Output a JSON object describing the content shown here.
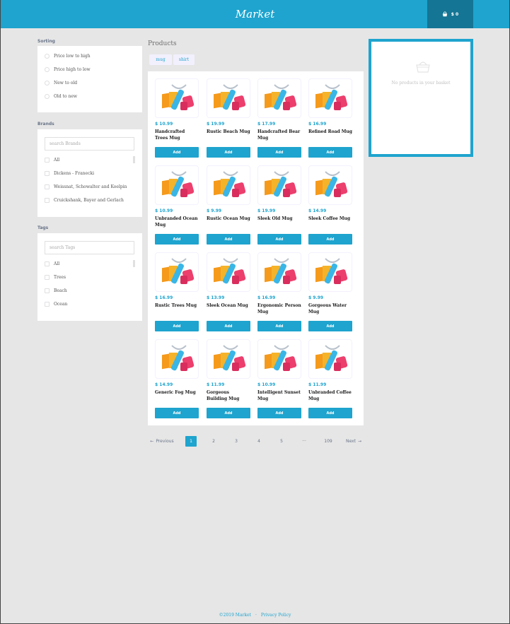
{
  "header": {
    "title": "Market",
    "basket_total": "$ 0"
  },
  "sorting": {
    "title": "Sorting",
    "options": [
      "Price low to high",
      "Price high to low",
      "New to old",
      "Old to new"
    ]
  },
  "brands": {
    "title": "Brands",
    "search_placeholder": "search Brands",
    "items": [
      "All",
      "Dickens - Franecki",
      "Weissnat, Schowalter and Koelpin",
      "Cruickshank, Bayer and Gerlach"
    ]
  },
  "tags": {
    "title": "Tags",
    "search_placeholder": "search Tags",
    "items": [
      "All",
      "Trees",
      "Beach",
      "Ocean"
    ]
  },
  "products": {
    "title": "Products",
    "types": [
      "mug",
      "shirt"
    ],
    "add_label": "Add",
    "items": [
      {
        "price": "$ 10.99",
        "name": "Handcrafted Trees Mug"
      },
      {
        "price": "$ 19.99",
        "name": "Rustic Beach Mug"
      },
      {
        "price": "$ 17.99",
        "name": "Handcrafted Bear Mug"
      },
      {
        "price": "$ 16.99",
        "name": "Refined Road Mug"
      },
      {
        "price": "$ 10.99",
        "name": "Unbranded Ocean Mug"
      },
      {
        "price": "$ 9.99",
        "name": "Rustic Ocean Mug"
      },
      {
        "price": "$ 19.99",
        "name": "Sleek Old Mug"
      },
      {
        "price": "$ 14.99",
        "name": "Sleek Coffee Mug"
      },
      {
        "price": "$ 16.99",
        "name": "Rustic Trees Mug"
      },
      {
        "price": "$ 13.99",
        "name": "Sleek Ocean Mug"
      },
      {
        "price": "$ 16.99",
        "name": "Ergonomic Person Mug"
      },
      {
        "price": "$ 9.99",
        "name": "Gorgeous Water Mug"
      },
      {
        "price": "$ 14.99",
        "name": "Generic Fog Mug"
      },
      {
        "price": "$ 11.99",
        "name": "Gorgeous Building Mug"
      },
      {
        "price": "$ 10.99",
        "name": "Intelligent Sunset Mug"
      },
      {
        "price": "$ 11.99",
        "name": "Unbranded Coffee Mug"
      }
    ]
  },
  "pagination": {
    "prev": "Previous",
    "next": "Next",
    "pages": [
      "1",
      "2",
      "3",
      "4",
      "5",
      "···",
      "109"
    ],
    "active": "1"
  },
  "basket": {
    "empty_text": "No products in your basket"
  },
  "footer": {
    "copyright": "©2019 Market",
    "separator": "·",
    "privacy": "Privacy Policy"
  },
  "colors": {
    "primary": "#1ea4ce",
    "primary_dark": "#147594",
    "background": "#e6e6e6"
  }
}
